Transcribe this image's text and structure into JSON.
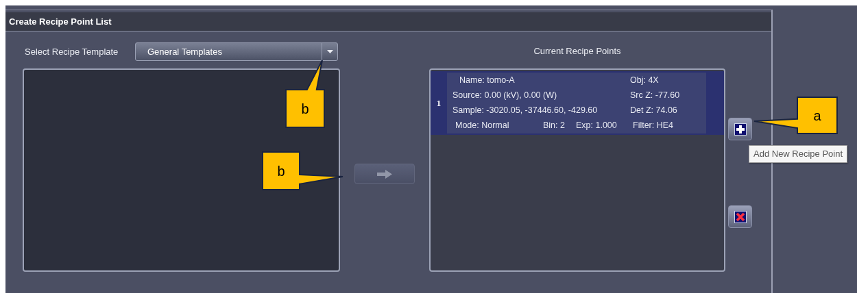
{
  "panel": {
    "title": "Create Recipe Point List"
  },
  "template": {
    "label": "Select Recipe Template",
    "value": "General Templates"
  },
  "transfer_button": {
    "disabled": true
  },
  "current": {
    "heading": "Current Recipe Points",
    "points": [
      {
        "index": "1",
        "selected": true,
        "lines": [
          [
            "Name: tomo-A",
            "Obj: 4X"
          ],
          [
            "Source: 0.00 (kV), 0.00 (W)",
            "Src Z: -77.60"
          ],
          [
            "Sample: -3020.05, -37446.60, -429.60",
            "Det Z: 74.06"
          ],
          [
            "Mode: Normal",
            "Bin: 2",
            "Exp: 1.000",
            "Filter: HE4"
          ]
        ]
      }
    ]
  },
  "tooltip": "Add New Recipe Point",
  "callouts": [
    {
      "label": "b"
    },
    {
      "label": "b"
    },
    {
      "label": "a"
    }
  ]
}
